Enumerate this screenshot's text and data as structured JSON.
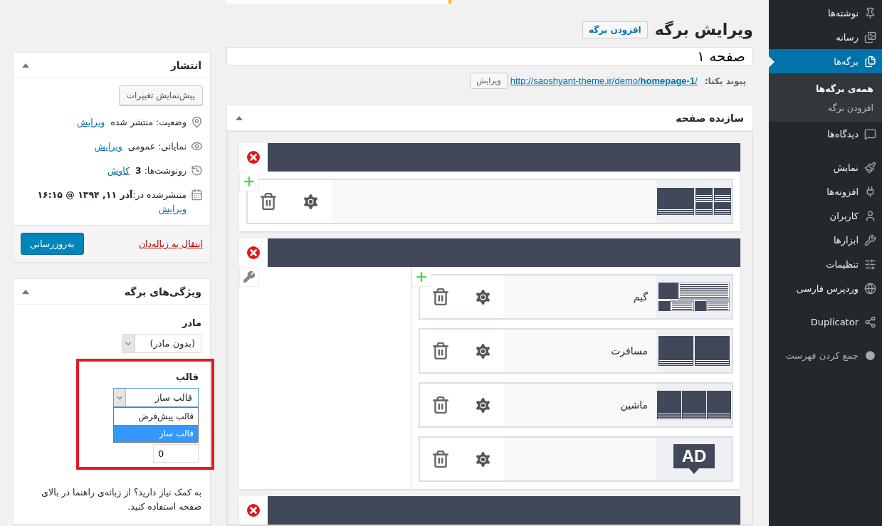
{
  "admin_menu": {
    "groups": [
      {
        "items": [
          {
            "label": "نوشته‌ها",
            "selected": false
          },
          {
            "label": "رسانه",
            "selected": false
          },
          {
            "label": "برگه‌ها",
            "selected": true,
            "children": [
              {
                "label": "همه‌ی برگه‌ها",
                "selected": true
              },
              {
                "label": "افزودن برگه",
                "selected": false
              }
            ]
          },
          {
            "label": "دیدگاه‌ها",
            "selected": false
          }
        ]
      },
      {
        "items": [
          {
            "label": "نمایش",
            "selected": false
          },
          {
            "label": "افزونه‌ها",
            "selected": false
          },
          {
            "label": "کاربران",
            "selected": false
          },
          {
            "label": "ابزارها",
            "selected": false
          },
          {
            "label": "تنظیمات",
            "selected": false
          },
          {
            "label": "وردپرس فارسی",
            "selected": false
          }
        ]
      },
      {
        "items": [
          {
            "label": "Duplicator",
            "selected": false
          }
        ]
      }
    ],
    "collapse": "جمع کردن فهرست"
  },
  "heading": {
    "title": "ویرایش برگه",
    "add_button": "افزودن برگه"
  },
  "title_field": {
    "value": "صفحه ۱"
  },
  "permalink": {
    "label": "پیوند یکتا:",
    "url": "http://saoshyant-theme.ir/demo/**homepage-1**/",
    "edit_button": "ویرایش"
  },
  "builder": {
    "title": "سازنده صفحه",
    "expanded": true,
    "rows": [
      {
        "columns": [
          {
            "modules": [
              {
                "kind": "mixed-grid"
              }
            ]
          }
        ]
      },
      {
        "columns": [
          {
            "modules": [
              {
                "kind": "list",
                "title": "گیم"
              },
              {
                "kind": "two-col",
                "title": "مسافرت"
              },
              {
                "kind": "three-col",
                "title": "ماشین"
              },
              {
                "kind": "ad",
                "badge": "AD"
              }
            ]
          },
          {}
        ]
      },
      {}
    ]
  },
  "publish": {
    "title": "انتشار",
    "expanded": true,
    "preview_button": "پیش‌نمایش تغییرات",
    "meta": [
      {
        "text": "وضعیت: منتشر شده",
        "link": "ویرایش"
      },
      {
        "text": "نمایانی: عمومی",
        "link": "ویرایش"
      },
      {
        "text": "رونوشت‌ها: **3**",
        "link": "کاوش"
      },
      {
        "text": "منتشرشده در:**آذر ۱۱, ۱۳۹۴ @ ۱۶:۱۵**",
        "link": "ویرایش"
      }
    ],
    "trash_link": "انتقال به زباله‌دان",
    "update_button": "به‌روزرسانی"
  },
  "page_attributes": {
    "title": "ویژگی‌های برگه",
    "expanded": true,
    "parent": {
      "label": "مادر",
      "value": "(بدون مادر)"
    },
    "template": {
      "label": "قالب",
      "value": "قالب ساز",
      "expanded": true,
      "highlighted": true,
      "options": [
        {
          "label": "قالب پیش‌فرض",
          "selected": false
        },
        {
          "label": "قالب ساز",
          "selected": true
        }
      ]
    },
    "order": {
      "value": "0"
    },
    "help": "به کمک نیاز دارید؟ از زبانه‌ی راهنما در بالای صفحه استفاده کنید."
  }
}
